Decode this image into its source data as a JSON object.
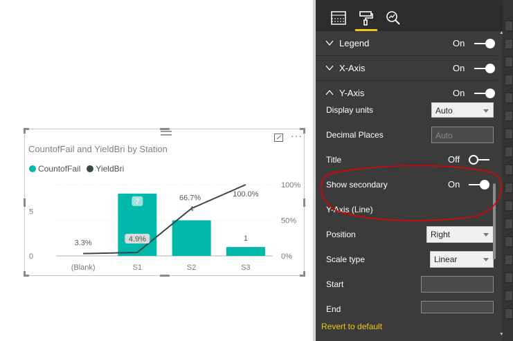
{
  "visual": {
    "title": "CountofFail and YieldBri by Station",
    "more_label": "···",
    "legend": [
      {
        "name": "CountofFail",
        "color": "#01b8aa"
      },
      {
        "name": "YieldBri",
        "color": "#374649"
      }
    ]
  },
  "chart_data": {
    "type": "bar",
    "categories": [
      "(Blank)",
      "S1",
      "S2",
      "S3"
    ],
    "series": [
      {
        "name": "CountofFail",
        "values": [
          0,
          7,
          4,
          1
        ],
        "data_labels": [
          "",
          "7",
          "4",
          "1"
        ],
        "color": "#01b8aa"
      },
      {
        "name": "YieldBri",
        "type": "line",
        "values": [
          3.3,
          4.9,
          66.7,
          100.0
        ],
        "data_labels": [
          "3.3%",
          "4.9%",
          "66.7%",
          "100.0%"
        ],
        "color": "#374649"
      }
    ],
    "primary_axis": {
      "ticks": [
        "0",
        "5"
      ],
      "ylim": [
        0,
        8
      ]
    },
    "secondary_axis": {
      "ticks": [
        "0%",
        "50%",
        "100%"
      ],
      "ylim": [
        0,
        100
      ]
    }
  },
  "pane": {
    "sections": [
      {
        "label": "Legend",
        "state": "On"
      },
      {
        "label": "X-Axis",
        "state": "On"
      },
      {
        "label": "Y-Axis",
        "state": "On"
      }
    ],
    "display_units": {
      "label": "Display units",
      "value": "Auto"
    },
    "decimal_places": {
      "label": "Decimal Places",
      "placeholder": "Auto"
    },
    "title_row": {
      "label": "Title",
      "state": "Off"
    },
    "show_secondary": {
      "label": "Show secondary",
      "state": "On"
    },
    "yaxis_line_heading": "Y-Axis (Line)",
    "position": {
      "label": "Position",
      "value": "Right"
    },
    "scale_type": {
      "label": "Scale type",
      "value": "Linear"
    },
    "start": {
      "label": "Start",
      "value": ""
    },
    "end": {
      "label": "End",
      "value": ""
    },
    "revert": "Revert to default"
  },
  "colors": {
    "accent": "#f2c811",
    "pane_bg": "#3b3b3b",
    "annotation": "#e00000"
  }
}
